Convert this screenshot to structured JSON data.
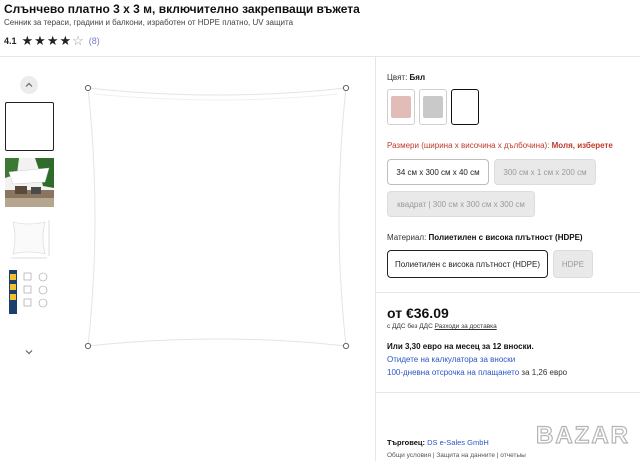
{
  "product": {
    "title": "Слънчево платно 3 х 3 м, включително закрепващи въжета",
    "subtitle": "Сенник за тераси, градини и балкони, изработен от HDPE платно, UV защита",
    "rating": "4.1",
    "rating_stars": 4,
    "review_count": "(8)"
  },
  "gallery": {
    "up_icon": "chevron-up-icon",
    "down_icon": "chevron-down-icon"
  },
  "options": {
    "color_label": "Цвят:",
    "color_value": "Бял",
    "swatch_colors": [
      "#e2bcb7",
      "#c9c9c9",
      "#ffffff"
    ],
    "size_label": "Размери (ширина х височина х дълбочина):",
    "size_value": "Моля, изберете",
    "sizes": [
      "34 см x 300 см x 40 см",
      "300 см x 1 см x 200 см",
      "квадрат | 300 см x 300 см x 300 см"
    ],
    "material_label": "Материал:",
    "material_value": "Полиетилен с висока плътност (HDPE)",
    "materials": [
      "Полиетилен с висока плътност (HDPE)",
      "HDPE"
    ]
  },
  "pricing": {
    "price": "от €36.09",
    "vat_text": "с ДДС без ДДС",
    "shipping_link": "Разходи за доставка",
    "monthly": "Или 3,30 евро на месец за 12 вноски.",
    "calculator_link": "Отидете на калкулатора за вноски",
    "deferral_link": "100-дневна отсрочка на плащането",
    "deferral_rest": " за 1,26 евро"
  },
  "seller": {
    "label": "Търговец:",
    "name": "DS e-Sales GmbH",
    "footer": "Общи условия | Защита на данните | отчетыы"
  },
  "watermark": "BAZAR"
}
